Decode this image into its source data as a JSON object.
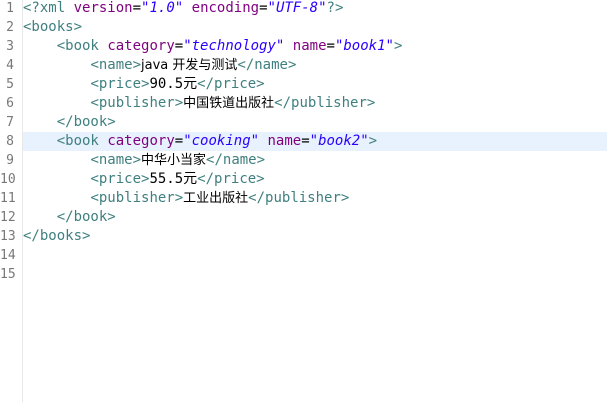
{
  "gutter": {
    "line_numbers": [
      "1",
      "2",
      "3",
      "4",
      "5",
      "6",
      "7",
      "8",
      "9",
      "10",
      "11",
      "12",
      "13",
      "14",
      "15"
    ]
  },
  "editor": {
    "current_line": 8,
    "colors": {
      "tag": "#3f7f7f",
      "attribute": "#7f007f",
      "attribute_value": "#2a00ff",
      "current_line_bg": "#e8f2fe"
    },
    "lines": [
      {
        "pi_open": "<?xml",
        "a1": "version",
        "v1": "\"1.0\"",
        "a2": "encoding",
        "v2": "\"UTF-8\"",
        "pi_close": "?>"
      },
      {
        "tag": "<books>"
      },
      {
        "indent": "    ",
        "tag_open": "<book",
        "a1": "category",
        "v1": "\"technology\"",
        "a2": "name",
        "v2": "\"book1\"",
        "tag_close": ">"
      },
      {
        "indent": "        ",
        "open": "<name>",
        "text": "java 开发与测试",
        "close": "</name>"
      },
      {
        "indent": "        ",
        "open": "<price>",
        "text": "90.5元",
        "close": "</price>"
      },
      {
        "indent": "        ",
        "open": "<publisher>",
        "text": "中国铁道出版社",
        "close": "</publisher>"
      },
      {
        "indent": "    ",
        "tag": "</book>"
      },
      {
        "indent": "    ",
        "tag_open": "<book",
        "a1": "category",
        "v1": "\"cooking\"",
        "a2": "name",
        "v2": "\"book2\"",
        "tag_close": ">"
      },
      {
        "indent": "        ",
        "open": "<name>",
        "text": "中华小当家",
        "close": "</name>"
      },
      {
        "indent": "        ",
        "open": "<price>",
        "text": "55.5元",
        "close": "</price>"
      },
      {
        "indent": "        ",
        "open": "<publisher>",
        "text": "工业出版社",
        "close": "</publisher>"
      },
      {
        "indent": "    ",
        "tag": "</book>"
      },
      {
        "tag": "</books>"
      }
    ]
  }
}
